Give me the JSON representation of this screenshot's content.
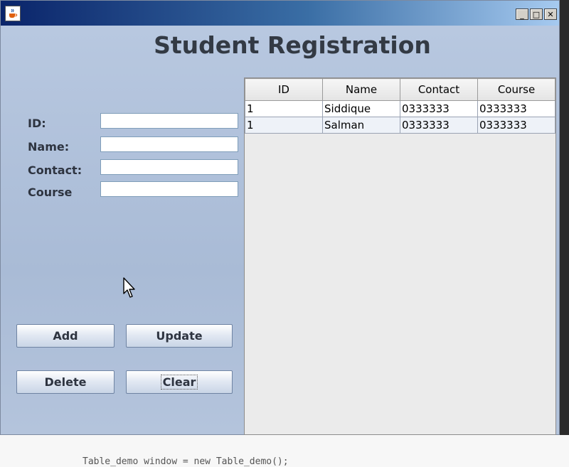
{
  "window": {
    "title": "",
    "controls": {
      "minimize": "_",
      "maximize": "□",
      "close": "✕"
    }
  },
  "form": {
    "heading": "Student Registration",
    "fields": [
      {
        "label": "ID:",
        "value": ""
      },
      {
        "label": "Name:",
        "value": ""
      },
      {
        "label": "Contact:",
        "value": ""
      },
      {
        "label": "Course",
        "value": ""
      }
    ],
    "buttons": {
      "add": "Add",
      "update": "Update",
      "delete": "Delete",
      "clear": "Clear"
    }
  },
  "table": {
    "columns": [
      "ID",
      "Name",
      "Contact",
      "Course"
    ],
    "rows": [
      [
        "1",
        "Siddique",
        "0333333",
        "0333333"
      ],
      [
        "1",
        "Salman",
        "0333333",
        "0333333"
      ]
    ]
  },
  "backdrop": {
    "code_line": "Table_demo window = new Table_demo();"
  },
  "colors": {
    "accent": "#0a246a",
    "window_bg": "#b6c6de"
  },
  "icons": {
    "app": "java-cup-icon",
    "cursor": "mouse-pointer-icon"
  }
}
